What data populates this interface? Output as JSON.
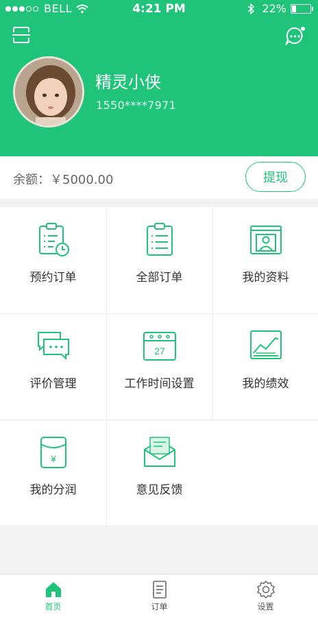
{
  "status_bar": {
    "carrier": "BELL",
    "time": "4:21 PM",
    "battery": "22%",
    "battery_level": 0.22
  },
  "profile": {
    "name": "精灵小侠",
    "phone": "1550****7971"
  },
  "balance": {
    "label": "余额：￥5000.00",
    "withdraw_label": "提现"
  },
  "grid": [
    {
      "label": "预约订单",
      "icon": "clipboard-clock-icon"
    },
    {
      "label": "全部订单",
      "icon": "clipboard-list-icon"
    },
    {
      "label": "我的资料",
      "icon": "profile-card-icon"
    },
    {
      "label": "评价管理",
      "icon": "chat-bubbles-icon"
    },
    {
      "label": "工作时间设置",
      "icon": "calendar-icon"
    },
    {
      "label": "我的绩效",
      "icon": "trend-chart-icon"
    },
    {
      "label": "我的分润",
      "icon": "money-envelope-icon"
    },
    {
      "label": "意见反馈",
      "icon": "mail-open-icon"
    }
  ],
  "calendar_day": "27",
  "tabs": [
    {
      "label": "首页",
      "icon": "home-icon",
      "active": true
    },
    {
      "label": "订单",
      "icon": "order-doc-icon",
      "active": false
    },
    {
      "label": "设置",
      "icon": "gear-icon",
      "active": false
    }
  ],
  "colors": {
    "brand": "#1fc47a",
    "background": "#f2f2f2"
  }
}
